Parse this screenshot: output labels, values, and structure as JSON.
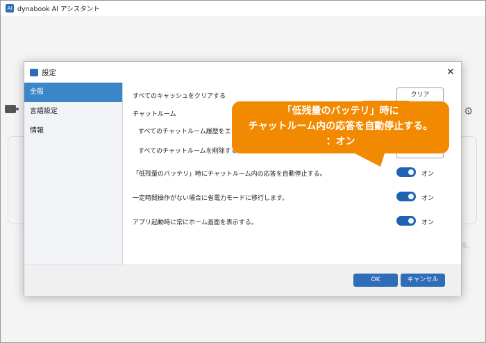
{
  "app": {
    "title": "dynabook AI アシスタント",
    "faint_text": "ろ。"
  },
  "dialog": {
    "title": "設定",
    "sidebar": [
      {
        "label": "全般",
        "active": true
      },
      {
        "label": "言語設定",
        "active": false
      },
      {
        "label": "情報",
        "active": false
      }
    ],
    "settings": {
      "clear_cache_label": "すべてのキャッシュをクリアする",
      "clear_button": "クリア",
      "chatroom_heading": "チャットルーム",
      "export_label": "すべてのチャットルーム履歴をエクス",
      "delete_label": "すべてのチャットルームを削除する",
      "low_battery_label": "「低残量のバッテリ」時にチャットルーム内の応答を自動停止する。",
      "low_battery_state": "オン",
      "power_save_label": "一定時間操作がない場合に省電力モードに移行します。",
      "power_save_state": "オン",
      "home_label": "アプリ起動時に常にホーム画面を表示する。",
      "home_state": "オン"
    },
    "ok_button": "OK",
    "cancel_button": "キャンセル"
  },
  "callout": {
    "line1": "「低残量のバッテリ」時に",
    "line2": "チャットルーム内の応答を自動停止する。",
    "line3": "：オン"
  },
  "colors": {
    "accent": "#2f6db8",
    "callout": "#f18a00",
    "sidebar_active": "#3a86c8"
  }
}
